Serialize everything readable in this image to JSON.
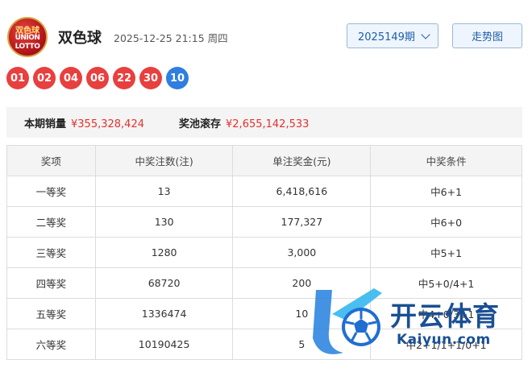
{
  "header": {
    "logo_text": [
      "双色球",
      "UNION",
      "LOTTO"
    ],
    "title": "双色球",
    "draw_time": "2025-12-25 21:15 周四",
    "issue_select": "2025149期",
    "trend_button": "走势图"
  },
  "balls": {
    "red": [
      "01",
      "02",
      "04",
      "06",
      "22",
      "30"
    ],
    "blue": [
      "10"
    ]
  },
  "colors": {
    "red_ball": "#e8403e",
    "blue_ball": "#2f7ee0",
    "accent_value": "#e3312d",
    "link_blue": "#1f5ea8"
  },
  "summary": {
    "sales_label": "本期销量",
    "sales_value": "¥355,328,424",
    "pool_label": "奖池滚存",
    "pool_value": "¥2,655,142,533"
  },
  "table": {
    "headers": [
      "奖项",
      "中奖注数(注)",
      "单注奖金(元)",
      "中奖条件"
    ],
    "rows": [
      [
        "一等奖",
        "13",
        "6,418,616",
        "中6+1"
      ],
      [
        "二等奖",
        "130",
        "177,327",
        "中6+0"
      ],
      [
        "三等奖",
        "1280",
        "3,000",
        "中5+1"
      ],
      [
        "四等奖",
        "68720",
        "200",
        "中5+0/4+1"
      ],
      [
        "五等奖",
        "1336474",
        "10",
        "中4+0/3+1"
      ],
      [
        "六等奖",
        "10190425",
        "5",
        "中2+1/1+1/0+1"
      ]
    ]
  },
  "watermark": {
    "name": "开云体育",
    "domain": "Kaiyun.com"
  }
}
